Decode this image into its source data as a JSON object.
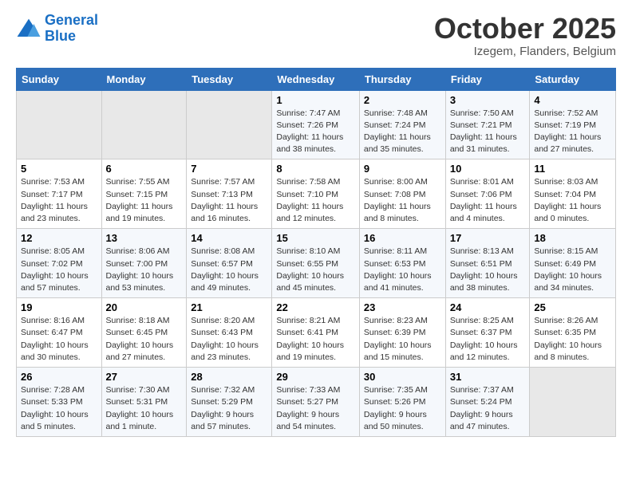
{
  "logo": {
    "line1": "General",
    "line2": "Blue"
  },
  "title": "October 2025",
  "location": "Izegem, Flanders, Belgium",
  "days_of_week": [
    "Sunday",
    "Monday",
    "Tuesday",
    "Wednesday",
    "Thursday",
    "Friday",
    "Saturday"
  ],
  "weeks": [
    [
      {
        "day": "",
        "info": ""
      },
      {
        "day": "",
        "info": ""
      },
      {
        "day": "",
        "info": ""
      },
      {
        "day": "1",
        "info": "Sunrise: 7:47 AM\nSunset: 7:26 PM\nDaylight: 11 hours\nand 38 minutes."
      },
      {
        "day": "2",
        "info": "Sunrise: 7:48 AM\nSunset: 7:24 PM\nDaylight: 11 hours\nand 35 minutes."
      },
      {
        "day": "3",
        "info": "Sunrise: 7:50 AM\nSunset: 7:21 PM\nDaylight: 11 hours\nand 31 minutes."
      },
      {
        "day": "4",
        "info": "Sunrise: 7:52 AM\nSunset: 7:19 PM\nDaylight: 11 hours\nand 27 minutes."
      }
    ],
    [
      {
        "day": "5",
        "info": "Sunrise: 7:53 AM\nSunset: 7:17 PM\nDaylight: 11 hours\nand 23 minutes."
      },
      {
        "day": "6",
        "info": "Sunrise: 7:55 AM\nSunset: 7:15 PM\nDaylight: 11 hours\nand 19 minutes."
      },
      {
        "day": "7",
        "info": "Sunrise: 7:57 AM\nSunset: 7:13 PM\nDaylight: 11 hours\nand 16 minutes."
      },
      {
        "day": "8",
        "info": "Sunrise: 7:58 AM\nSunset: 7:10 PM\nDaylight: 11 hours\nand 12 minutes."
      },
      {
        "day": "9",
        "info": "Sunrise: 8:00 AM\nSunset: 7:08 PM\nDaylight: 11 hours\nand 8 minutes."
      },
      {
        "day": "10",
        "info": "Sunrise: 8:01 AM\nSunset: 7:06 PM\nDaylight: 11 hours\nand 4 minutes."
      },
      {
        "day": "11",
        "info": "Sunrise: 8:03 AM\nSunset: 7:04 PM\nDaylight: 11 hours\nand 0 minutes."
      }
    ],
    [
      {
        "day": "12",
        "info": "Sunrise: 8:05 AM\nSunset: 7:02 PM\nDaylight: 10 hours\nand 57 minutes."
      },
      {
        "day": "13",
        "info": "Sunrise: 8:06 AM\nSunset: 7:00 PM\nDaylight: 10 hours\nand 53 minutes."
      },
      {
        "day": "14",
        "info": "Sunrise: 8:08 AM\nSunset: 6:57 PM\nDaylight: 10 hours\nand 49 minutes."
      },
      {
        "day": "15",
        "info": "Sunrise: 8:10 AM\nSunset: 6:55 PM\nDaylight: 10 hours\nand 45 minutes."
      },
      {
        "day": "16",
        "info": "Sunrise: 8:11 AM\nSunset: 6:53 PM\nDaylight: 10 hours\nand 41 minutes."
      },
      {
        "day": "17",
        "info": "Sunrise: 8:13 AM\nSunset: 6:51 PM\nDaylight: 10 hours\nand 38 minutes."
      },
      {
        "day": "18",
        "info": "Sunrise: 8:15 AM\nSunset: 6:49 PM\nDaylight: 10 hours\nand 34 minutes."
      }
    ],
    [
      {
        "day": "19",
        "info": "Sunrise: 8:16 AM\nSunset: 6:47 PM\nDaylight: 10 hours\nand 30 minutes."
      },
      {
        "day": "20",
        "info": "Sunrise: 8:18 AM\nSunset: 6:45 PM\nDaylight: 10 hours\nand 27 minutes."
      },
      {
        "day": "21",
        "info": "Sunrise: 8:20 AM\nSunset: 6:43 PM\nDaylight: 10 hours\nand 23 minutes."
      },
      {
        "day": "22",
        "info": "Sunrise: 8:21 AM\nSunset: 6:41 PM\nDaylight: 10 hours\nand 19 minutes."
      },
      {
        "day": "23",
        "info": "Sunrise: 8:23 AM\nSunset: 6:39 PM\nDaylight: 10 hours\nand 15 minutes."
      },
      {
        "day": "24",
        "info": "Sunrise: 8:25 AM\nSunset: 6:37 PM\nDaylight: 10 hours\nand 12 minutes."
      },
      {
        "day": "25",
        "info": "Sunrise: 8:26 AM\nSunset: 6:35 PM\nDaylight: 10 hours\nand 8 minutes."
      }
    ],
    [
      {
        "day": "26",
        "info": "Sunrise: 7:28 AM\nSunset: 5:33 PM\nDaylight: 10 hours\nand 5 minutes."
      },
      {
        "day": "27",
        "info": "Sunrise: 7:30 AM\nSunset: 5:31 PM\nDaylight: 10 hours\nand 1 minute."
      },
      {
        "day": "28",
        "info": "Sunrise: 7:32 AM\nSunset: 5:29 PM\nDaylight: 9 hours\nand 57 minutes."
      },
      {
        "day": "29",
        "info": "Sunrise: 7:33 AM\nSunset: 5:27 PM\nDaylight: 9 hours\nand 54 minutes."
      },
      {
        "day": "30",
        "info": "Sunrise: 7:35 AM\nSunset: 5:26 PM\nDaylight: 9 hours\nand 50 minutes."
      },
      {
        "day": "31",
        "info": "Sunrise: 7:37 AM\nSunset: 5:24 PM\nDaylight: 9 hours\nand 47 minutes."
      },
      {
        "day": "",
        "info": ""
      }
    ]
  ]
}
